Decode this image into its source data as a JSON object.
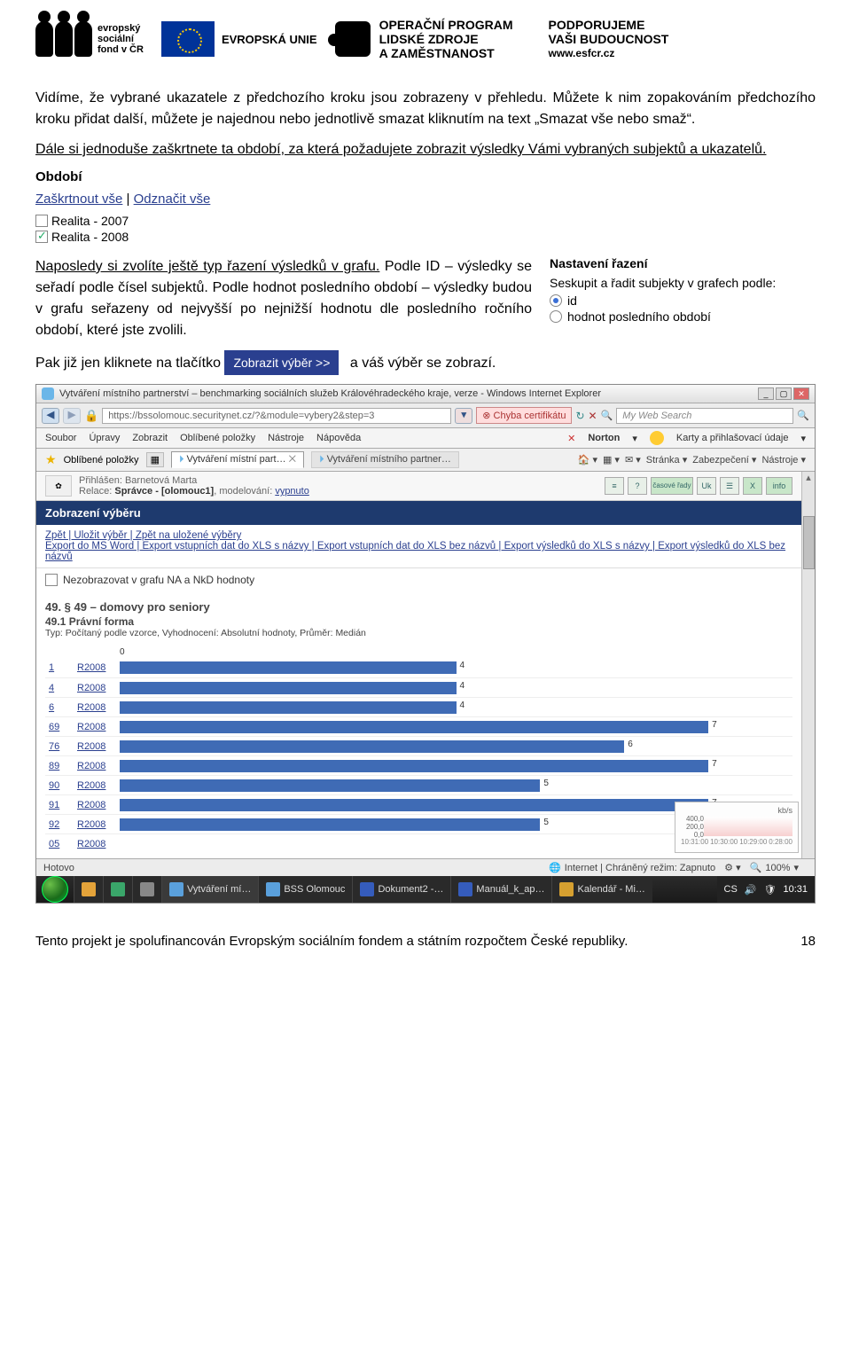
{
  "header": {
    "esf_caption": "evropský\nsociální\nfond v ČR",
    "eu_caption": "EVROPSKÁ UNIE",
    "op_line1": "OPERAČNÍ PROGRAM",
    "op_line2": "LIDSKÉ ZDROJE",
    "op_line3": "A ZAMĚSTNANOST",
    "support_line1": "PODPORUJEME",
    "support_line2": "VAŠI BUDOUCNOST",
    "support_link": "www.esfcr.cz"
  },
  "doc": {
    "para1": "Vidíme, že vybrané ukazatele z předchozího kroku jsou zobrazeny v přehledu. Můžete k nim zopakováním předchozího kroku přidat další, můžete je najednou nebo jednotlivě smazat kliknutím na text „Smazat vše nebo smaž“.",
    "para1u": "Dále si jednoduše zaškrtnete ta období, za která požadujete zobrazit výsledky Vámi vybraných subjektů a ukazatelů.",
    "obdobi_title": "Období",
    "zaskrtnout": "Zaškrtnout vše",
    "odznacit": "Odznačit vše",
    "period1": "Realita - 2007",
    "period2": "Realita - 2008",
    "para2u": "Naposledy si zvolíte ještě typ řazení výsledků v grafu.",
    "para2": " Podle ID – výsledky se seřadí podle čísel subjektů. Podle hodnot posledního období – výsledky budou v grafu seřazeny od nejvyšší po nejnižší hodnotu dle posledního ročního období, které jste zvolili.",
    "settings_title": "Nastavení řazení",
    "settings_label": "Seskupit a řadit subjekty v grafech podle:",
    "radio_id": "id",
    "radio_hodnot": "hodnot posledního období",
    "para3a": "Pak již jen kliknete na tlačítko",
    "button_text": "Zobrazit výběr >>",
    "para3b": "a váš výběr se zobrazí."
  },
  "ie": {
    "title": "Vytváření místního partnerství – benchmarking sociálních služeb Královéhradeckého kraje, verze  - Windows Internet Explorer",
    "url": "https://bssolomouc.securitynet.cz/?&module=vybery2&step=3",
    "cert_error": "Chyba certifikátu",
    "search_placeholder": "My Web Search",
    "menu": [
      "Soubor",
      "Úpravy",
      "Zobrazit",
      "Oblíbené položky",
      "Nástroje",
      "Nápověda"
    ],
    "norton": "Norton",
    "karty": "Karty a přihlašovací údaje",
    "fav_label": "Oblíbené položky",
    "tab1": "Vytváření místní part…",
    "tab2": "Vytváření místního partner…",
    "toolbar_right": [
      "Stránka ▾",
      "Zabezpečení ▾",
      "Nástroje ▾"
    ],
    "login_line1": "Přihlášen: Barnetová Marta",
    "login_line2a": "Relace: ",
    "login_line2b": "Správce - [olomouc1]",
    "login_line2c": ", modelování: ",
    "login_line2d": "vypnuto",
    "icon_labels": [
      "≡",
      "?",
      "časové řady",
      "Uk",
      "☰",
      "X",
      "info"
    ],
    "blue_heading": "Zobrazení výběru",
    "links_line1": "Zpět | Uložit výběr | Zpět na uložené výběry",
    "links_line2": "Export do MS Word | Export vstupních dat do XLS s názvy | Export vstupních dat do XLS bez názvů | Export výsledků do XLS s názvy | Export výsledků do XLS bez názvů",
    "nezob_label": "Nezobrazovat v grafu NA a NkD hodnoty",
    "section_title": "49. § 49 – domovy pro seniory",
    "section_sub": "49.1 Právní forma",
    "section_meta": "Typ: Počítaný podle vzorce, Vyhodnocení: Absolutní hodnoty, Průměr: Medián",
    "corner": {
      "vals": [
        "400,0",
        "200,0",
        "0,0"
      ],
      "ticks": [
        "10:31:00",
        "10:30:00",
        "10:29:00",
        "0:28:00"
      ],
      "unit": "kb/s"
    },
    "status_left": "Hotovo",
    "status_mid": "Internet | Chráněný režim: Zapnuto",
    "zoom": "100%"
  },
  "chart_data": {
    "type": "bar",
    "title": "49.1 Právní forma",
    "xlabel": "",
    "ylabel": "",
    "xlim": [
      0,
      8
    ],
    "categories": [
      "1",
      "4",
      "6",
      "69",
      "76",
      "89",
      "90",
      "91",
      "92",
      "05"
    ],
    "year": "R2008",
    "values": [
      4,
      4,
      4,
      7,
      6,
      7,
      5,
      7,
      5,
      null
    ]
  },
  "taskbar": {
    "items": [
      "",
      "",
      "",
      "Vytváření mí…",
      "BSS Olomouc",
      "Dokument2 -…",
      "Manuál_k_ap…",
      "Kalendář - Mi…"
    ],
    "tray_lang": "CS",
    "tray_time": "10:31"
  },
  "footer": {
    "text": "Tento projekt je spolufinancován Evropským sociálním fondem a státním rozpočtem České republiky.",
    "page": "18"
  }
}
